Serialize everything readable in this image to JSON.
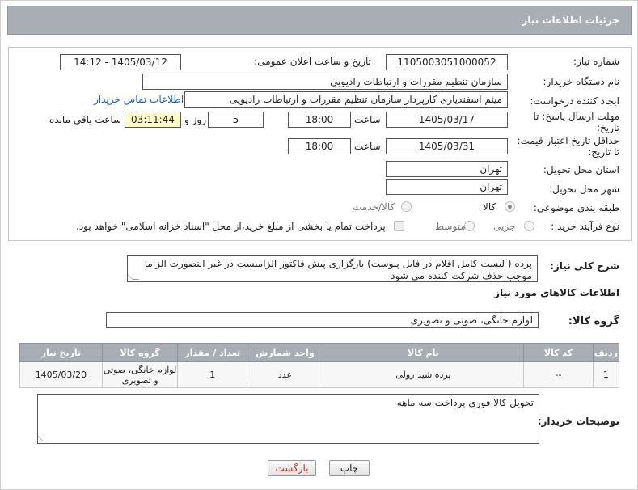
{
  "header": {
    "title": "جزئیات اطلاعات نیاز"
  },
  "fields": {
    "need_number_label": "شماره نیاز:",
    "need_number": "1105003051000052",
    "announce_label": "تاریخ و ساعت اعلان عمومی:",
    "announce_value": "1405/03/12 - 14:12",
    "buyer_org_label": "نام دستگاه خریدار:",
    "buyer_org": "سازمان تنظیم مقررات و ارتباطات رادیویی",
    "creator_label": "ایجاد کننده درخواست:",
    "creator": "میثم اسفندیاری کارپرداز سازمان تنظیم مقررات و ارتباطات رادیویی",
    "contact_link": "اطلاعات تماس خریدار",
    "deadline_label_1": "مهلت ارسال پاسخ: تا",
    "deadline_label_2": "تاریخ:",
    "deadline_date": "1405/03/17",
    "time_label": "ساعت",
    "deadline_time": "18:00",
    "days_value": "5",
    "days_label": "روز و",
    "remaining_time": "03:11:44",
    "remaining_label": "ساعت باقی مانده",
    "validity_label_1": "حداقل تاریخ اعتبار قیمت:",
    "validity_label_2": "تا تاریخ:",
    "validity_date": "1405/03/31",
    "validity_time": "18:00",
    "province_label": "استان محل تحویل:",
    "province": "تهران",
    "city_label": "شهر محل تحویل:",
    "city": "تهران",
    "category_label": "طبقه بندی موضوعی:",
    "category_options": [
      "کالا",
      "کالا/خدمت"
    ],
    "category_selected": "کالا",
    "process_label": "نوع فرآیند خرید :",
    "process_options": [
      "جزیی",
      "متوسط"
    ],
    "payment_note": "پرداخت تمام یا بخشی از مبلغ خرید،از محل \"اسناد خزانه اسلامی\" خواهد بود."
  },
  "summary": {
    "label": "شرح کلی نیاز:",
    "text": "پرده ( لیست کامل اقلام در فایل پیوست) بارگزاری پیش فاکتور الزامیست در غیر اینصورت الزاما موجب حذف شرکت کننده می شود"
  },
  "goods": {
    "section_title": "اطلاعات کالاهای مورد نیاز",
    "group_label": "گروه کالا:",
    "group_value": "لوازم خانگی، صوتی و تصویری",
    "columns": [
      "ردیف",
      "کد کالا",
      "نام کالا",
      "واحد شمارش",
      "تعداد / مقدار",
      "گروه کالا",
      "تاریخ نیاز"
    ],
    "rows": [
      {
        "row": "1",
        "code": "--",
        "name": "پرده شید رولی",
        "unit": "عدد",
        "qty": "1",
        "group": "لوازم خانگی، صوتی و تصویری",
        "date": "1405/03/20"
      }
    ]
  },
  "buyer_notes": {
    "label": "توضیحات خریدار:",
    "text": "تحویل کالا فوری پرداخت سه ماهه"
  },
  "buttons": {
    "print": "چاپ",
    "back": "بازگشت"
  },
  "colors": {
    "header_bg": "#a9aeb4",
    "link": "#1a5fb4",
    "back_text": "#c0392b",
    "remaining_bg": "#ffffcc"
  }
}
